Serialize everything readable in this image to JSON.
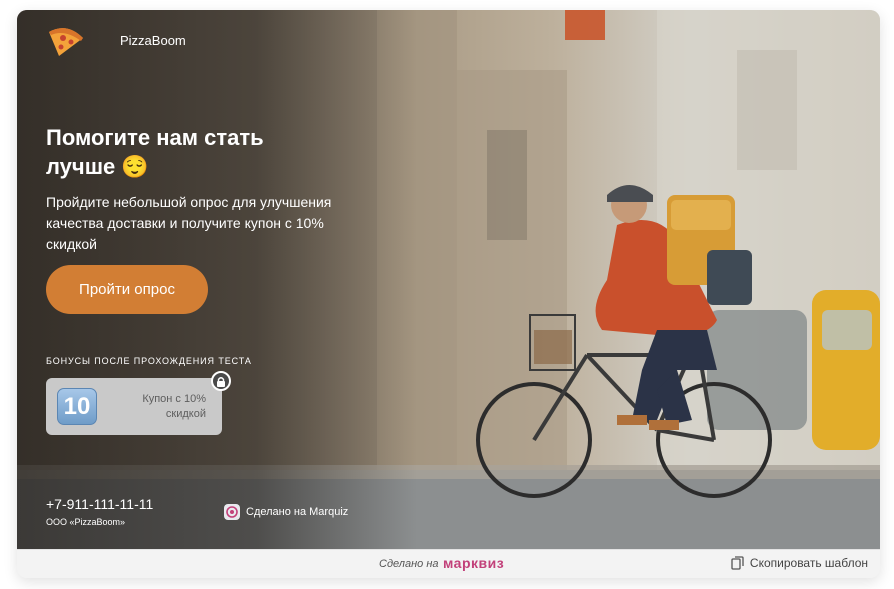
{
  "brand": {
    "name": "PizzaBoom"
  },
  "hero": {
    "title": "Помогите нам стать лучше 😌",
    "subtitle": "Пройдите небольшой опрос для улучшения качества доставки и получите купон с 10% скидкой",
    "cta_label": "Пройти опрос"
  },
  "bonus": {
    "label": "БОНУСЫ ПОСЛЕ ПРОХОЖДЕНИЯ ТЕСТА",
    "coupon_number": "10",
    "coupon_text": "Купон с 10% скидкой"
  },
  "contacts": {
    "phone": "+7-911-111-11-11",
    "company": "ООО «PizzaBoom»"
  },
  "badge": {
    "text": "Сделано на Marquiz"
  },
  "footer": {
    "made_on": "Сделано на",
    "made_brand": "марквиз",
    "copy_label": "Скопировать шаблон"
  },
  "colors": {
    "accent": "#d27e34",
    "footer_brand": "#c2417a",
    "coupon_bg": "#c9c9c9"
  },
  "icons": [
    "pizza-logo-icon",
    "lock-icon",
    "marquiz-icon",
    "copy-icon"
  ]
}
